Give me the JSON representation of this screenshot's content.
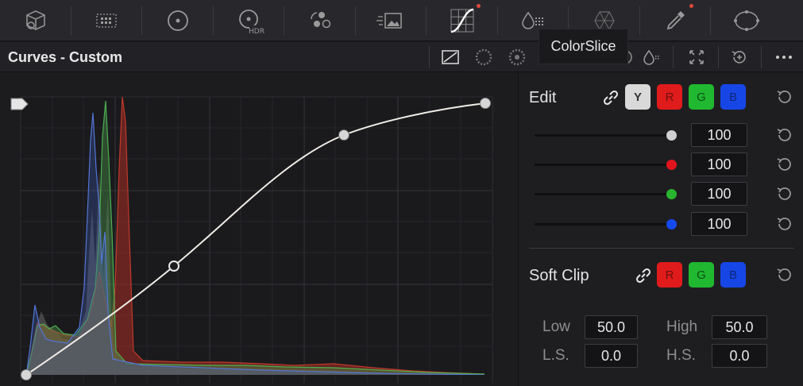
{
  "toolbar": {
    "tools": [
      {
        "name": "camera-raw-icon"
      },
      {
        "name": "color-match-icon"
      },
      {
        "name": "primaries-wheels-icon"
      },
      {
        "name": "hdr-wheels-icon",
        "text": "HDR"
      },
      {
        "name": "rgb-mixer-icon"
      },
      {
        "name": "motion-effects-icon"
      },
      {
        "name": "curves-icon",
        "active": true,
        "badge": true
      },
      {
        "name": "color-warper-icon"
      },
      {
        "name": "qualifier-icon"
      },
      {
        "name": "eyedropper-icon",
        "badge": true
      },
      {
        "name": "window-icon"
      }
    ]
  },
  "title": "Curves - Custom",
  "tooltip": "ColorSlice",
  "edit": {
    "label": "Edit",
    "channels": [
      "Y",
      "R",
      "G",
      "B"
    ],
    "sliders": [
      {
        "channel": "Y",
        "value": "100",
        "color": "#d0d0d0"
      },
      {
        "channel": "R",
        "value": "100",
        "color": "#e0141c"
      },
      {
        "channel": "G",
        "value": "100",
        "color": "#29b62e"
      },
      {
        "channel": "B",
        "value": "100",
        "color": "#1749f0"
      }
    ]
  },
  "softclip": {
    "label": "Soft Clip",
    "channels": [
      "R",
      "G",
      "B"
    ],
    "low_label": "Low",
    "low_value": "50.0",
    "high_label": "High",
    "high_value": "50.0",
    "ls_label": "L.S.",
    "ls_value": "0.0",
    "hs_label": "H.S.",
    "hs_value": "0.0"
  },
  "curve": {
    "control_points": [
      [
        0,
        0
      ],
      [
        0.33,
        0.32
      ],
      [
        0.7,
        0.81
      ],
      [
        1.0,
        1.0
      ]
    ]
  },
  "colors": {
    "accent_red": "#e0483c",
    "panel_bg": "#1c1c1f"
  }
}
